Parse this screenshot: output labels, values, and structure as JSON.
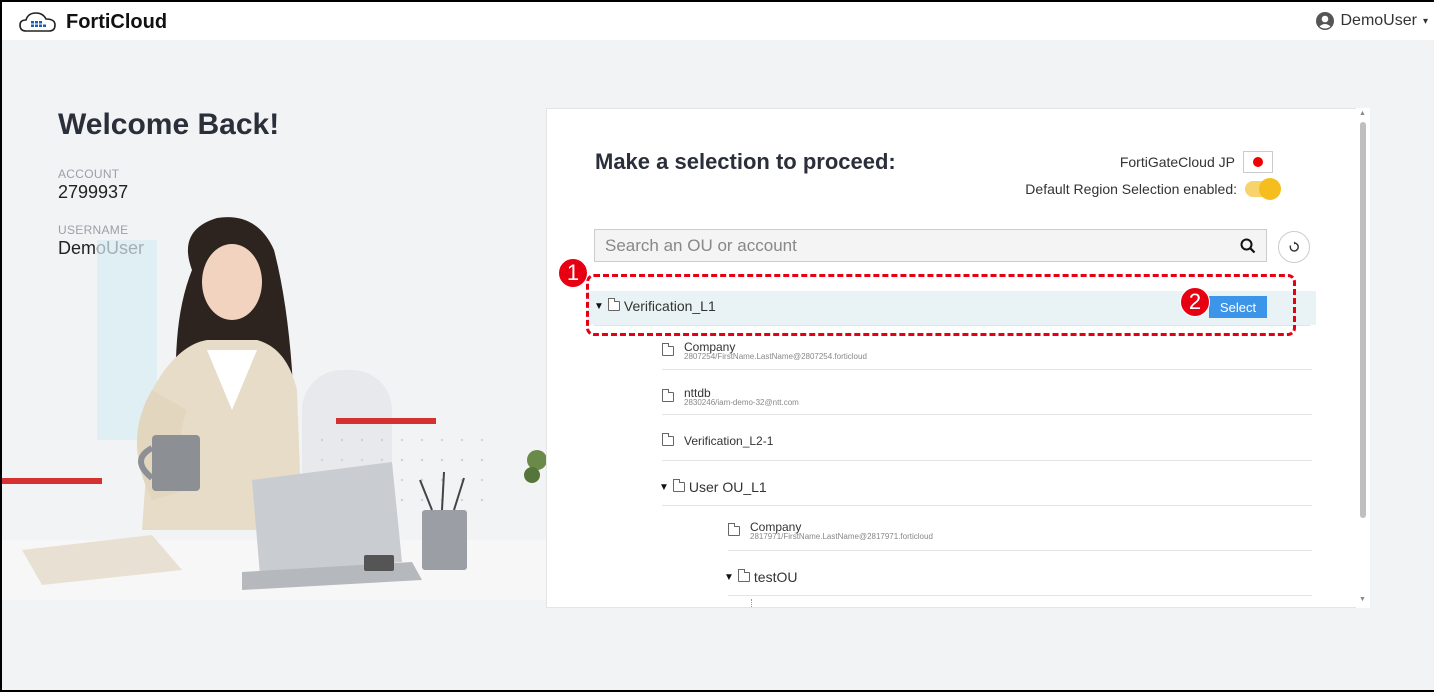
{
  "header": {
    "brand": "FortiCloud",
    "user": "DemoUser",
    "brand_icon": "forticloud-logo-icon",
    "user_icon": "user-circle-icon"
  },
  "welcome": {
    "title": "Welcome Back!",
    "account_label": "ACCOUNT",
    "account_value": "2799937",
    "username_label": "USERNAME",
    "username_value": "DemoUser"
  },
  "selection": {
    "title": "Make a selection to proceed:",
    "region_label": "FortiGateCloud JP",
    "default_region_label": "Default Region Selection enabled:",
    "default_region_enabled": true,
    "search_placeholder": "Search an OU or account",
    "search_icon": "search-icon",
    "refresh_icon": "refresh-icon",
    "select_label": "Select"
  },
  "tree": {
    "root": "Verification_L1",
    "items": [
      {
        "type": "account",
        "name": "Company",
        "sub": "2807254/FirstName.LastName@2807254.forticloud"
      },
      {
        "type": "account",
        "name": "nttdb",
        "sub": "2830246/iam-demo-32@ntt.com"
      },
      {
        "type": "ou",
        "name": "Verification_L2-1"
      },
      {
        "type": "ou",
        "name": "User OU_L1"
      },
      {
        "type": "account",
        "name": "Company",
        "sub": "2817971/FirstName.LastName@2817971.forticloud"
      },
      {
        "type": "ou",
        "name": "testOU"
      }
    ]
  },
  "annotations": {
    "step1": "1",
    "step2": "2"
  },
  "colors": {
    "accent": "#3c95e8",
    "annotation": "#e60012",
    "toggle": "#f5be1e",
    "panel_bg": "#f2f3f5"
  }
}
